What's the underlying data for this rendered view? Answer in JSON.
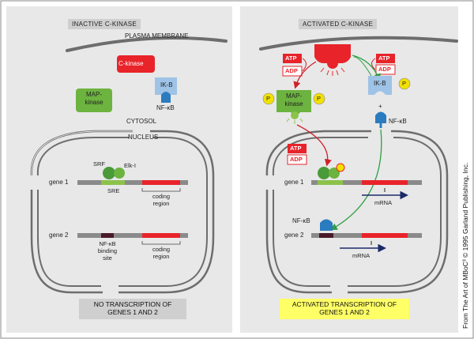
{
  "left_panel": {
    "title": "INACTIVE C-KINASE",
    "plasma_membrane": "PLASMA MEMBRANE",
    "c_kinase": "C-kinase",
    "map_kinase_1": "MAP-",
    "map_kinase_2": "kinase",
    "ik_b": "IK-B",
    "nf_kb": "NF-κB",
    "cytosol": "CYTOSOL",
    "nucleus": "NUCLEUS",
    "srf": "SRF",
    "elk": "Elk-I",
    "sre": "SRE",
    "gene1": "gene 1",
    "gene2": "gene 2",
    "coding_region_1a": "coding",
    "coding_region_1b": "region",
    "coding_region_2a": "coding",
    "coding_region_2b": "region",
    "nfkb_site_1": "NF-κB",
    "nfkb_site_2": "binding",
    "nfkb_site_3": "site",
    "footer_1": "NO TRANSCRIPTION OF",
    "footer_2": "GENES 1 AND 2"
  },
  "right_panel": {
    "title": "ACTIVATED C-KINASE",
    "atp": "ATP",
    "adp": "ADP",
    "p": "P",
    "map_kinase_1": "MAP-",
    "map_kinase_2": "kinase",
    "ik_b": "IK-B",
    "nf_kb": "NF-κB",
    "nf_kb_nuc": "NF-κB",
    "gene1": "gene 1",
    "gene2": "gene 2",
    "mrna": "mRNA",
    "plus": "+",
    "footer_1": "ACTIVATED TRANSCRIPTION OF",
    "footer_2": "GENES 1 AND 2"
  },
  "credit": "From The Art of MBoC³ © 1995 Garland Publishing, Inc.",
  "colors": {
    "panel_bg": "#e8e8e8",
    "membrane": "#6d6d6d",
    "c_kinase": "#e8232a",
    "map_kinase": "#6cb33f",
    "ikb": "#9ec3e6",
    "nfkb": "#2b7bc0",
    "phosphate": "#f2e000",
    "sre": "#8bc34a",
    "coding": "#e8232a",
    "nfkb_site": "#4a1a2a",
    "highlight": "#ffff66",
    "arrow_green": "#2ea043",
    "arrow_red": "#d0202a"
  }
}
